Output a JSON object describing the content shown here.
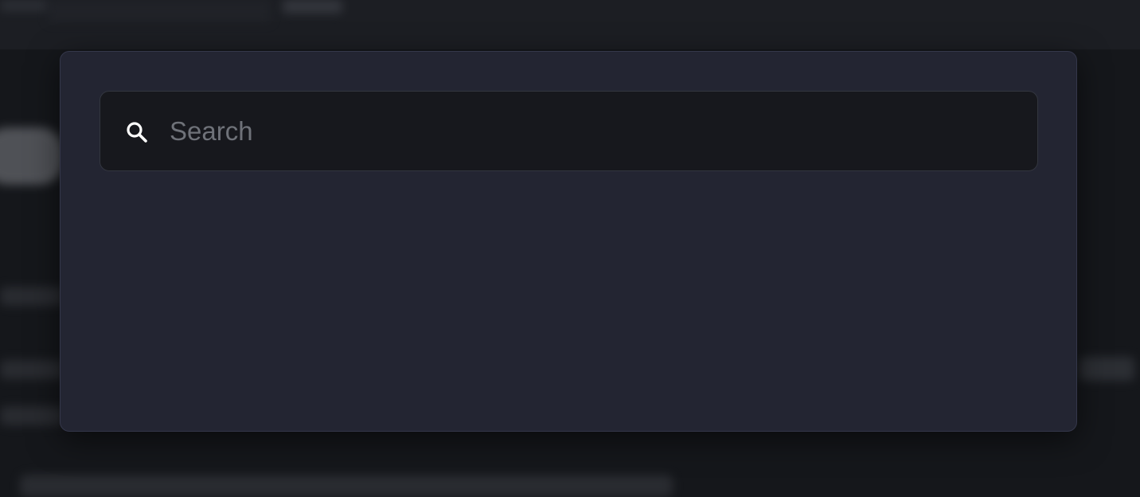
{
  "search": {
    "placeholder": "Search",
    "value": "",
    "icon": "search-icon"
  },
  "colors": {
    "modal_bg": "#232532",
    "input_bg": "#17181d",
    "placeholder": "#6f7279",
    "icon": "#ffffff"
  }
}
